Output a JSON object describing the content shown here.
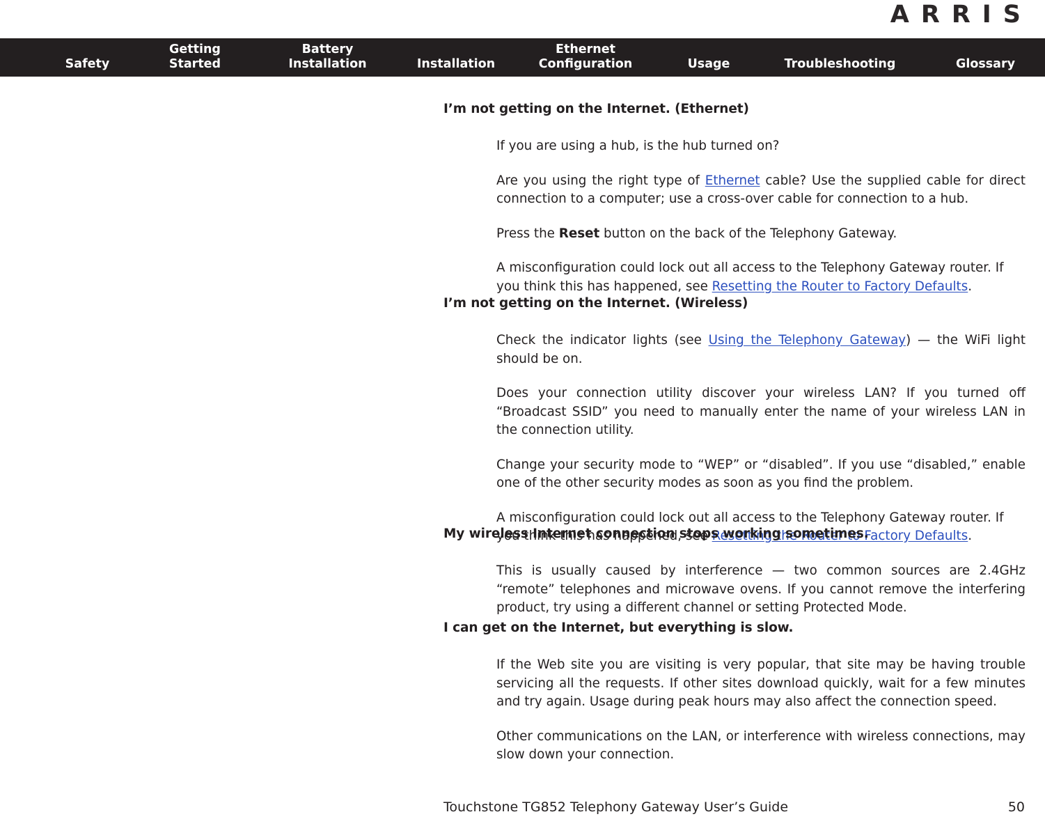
{
  "brand": {
    "logo_text": "ARRIS"
  },
  "nav": {
    "items": [
      {
        "label": "Safety"
      },
      {
        "label": "Getting\nStarted"
      },
      {
        "label": "Battery\nInstallation"
      },
      {
        "label": "Installation"
      },
      {
        "label": "Ethernet\nConfiguration"
      },
      {
        "label": "Usage"
      },
      {
        "label": "Troubleshooting"
      },
      {
        "label": "Glossary"
      }
    ]
  },
  "sections": [
    {
      "heading": "I’m not getting on the Internet. (Ethernet)",
      "paragraphs": [
        {
          "p1": "If you are using a hub, is the hub turned on?"
        },
        {
          "p1": "Are you using the right type of ",
          "link": "Ethernet",
          "p2": " cable? Use the supplied cable for direct connection to a computer; use a cross-over cable for connection to a hub."
        },
        {
          "p1": "Press the ",
          "bold": "Reset",
          "p2": " button on the back of the Telephony Gateway."
        },
        {
          "p1": "A misconfiguration could lock out all access to the Telephony Gateway router. If you think this has happened, see ",
          "link": "Resetting the Router to Factory Defaults",
          "p2": "."
        }
      ]
    },
    {
      "heading": "I’m not getting on the Internet. (Wireless)",
      "paragraphs": [
        {
          "p1": "Check the indicator lights (see ",
          "link": "Using the Telephony Gateway",
          "p2": ") — the WiFi light should be on."
        },
        {
          "p1": "Does your connection utility discover your wireless LAN? If you turned off “Broadcast SSID” you need to manually enter the name of your wireless LAN in the connection utility."
        },
        {
          "p1": "Change your security mode to “WEP” or “disabled”. If you use “disabled,” enable one of the other security modes as soon as you find the problem."
        },
        {
          "p1": "A misconfiguration could lock out all access to the Telephony Gateway router. If you think this has happened, see ",
          "link": "Resetting the Router to Factory Defaults",
          "p2": "."
        }
      ]
    },
    {
      "heading": "My wireless Internet connection stops working sometimes.",
      "paragraphs": [
        {
          "p1": "This is usually caused by interference — two common sources are 2.4GHz “remote” telephones and microwave ovens. If you cannot remove the interfering product, try using a different channel or setting Protected Mode."
        }
      ]
    },
    {
      "heading": "I can get on the Internet, but everything is slow.",
      "paragraphs": [
        {
          "p1": "If the Web site you are visiting is very popular, that site may be having trouble servicing all the requests. If other sites download quickly, wait for a few minutes and try again. Usage during peak hours may also affect the connection speed."
        },
        {
          "p1": "Other communications on the LAN, or interference with wireless connections, may slow down your connection."
        }
      ]
    }
  ],
  "footer": {
    "title": "Touchstone TG852 Telephony Gateway User’s Guide",
    "page_number": "50"
  }
}
